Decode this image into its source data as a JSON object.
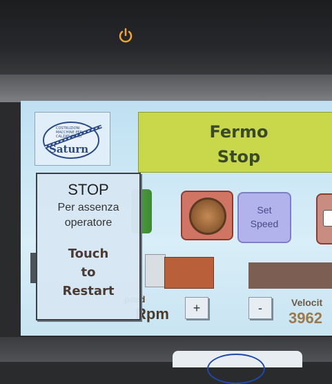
{
  "device": {
    "icon": "power-icon",
    "power_led_color": "#f5a623"
  },
  "screen": {
    "status": {
      "line1": "Fermo",
      "line2": "Stop",
      "color": "#c9d84a"
    },
    "logo": {
      "text": "Saturn",
      "tagline_lines": [
        "COSTRUZIONI",
        "MACCHINE PER",
        "CALZATURIFICI"
      ]
    },
    "buttons": {
      "set_speed_line1": "Set",
      "set_speed_line2": "Speed",
      "plus": "+",
      "minus": "-"
    },
    "speed": {
      "label": "peed",
      "unit": "Rpm"
    },
    "velocity": {
      "label": "Velocit",
      "value": "3962"
    },
    "stop_dialog": {
      "title": "STOP",
      "line1": "Per assenza",
      "line2": "operatore",
      "action1": "Touch",
      "action2": "to",
      "action3": "Restart"
    }
  }
}
